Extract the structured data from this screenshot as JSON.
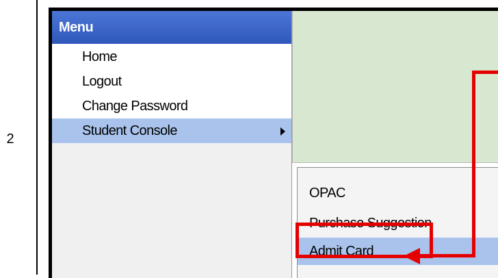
{
  "step": {
    "number": "2"
  },
  "menu": {
    "header": "Menu",
    "items": [
      {
        "label": "Home"
      },
      {
        "label": "Logout"
      },
      {
        "label": "Change Password"
      },
      {
        "label": "Student Console",
        "has_submenu": true,
        "active": true
      }
    ]
  },
  "submenu": {
    "items": [
      {
        "label": "OPAC"
      },
      {
        "label": "Purchase Suggestion"
      },
      {
        "label": "Admit Card",
        "active": true,
        "highlighted": true
      }
    ]
  },
  "annotation": {
    "color": "#e50000",
    "icon": "arrow-left-icon"
  },
  "colors": {
    "menu_header": "#2f58bb",
    "active_item": "#a9c3ec",
    "content_background": "#d8e8d0"
  }
}
